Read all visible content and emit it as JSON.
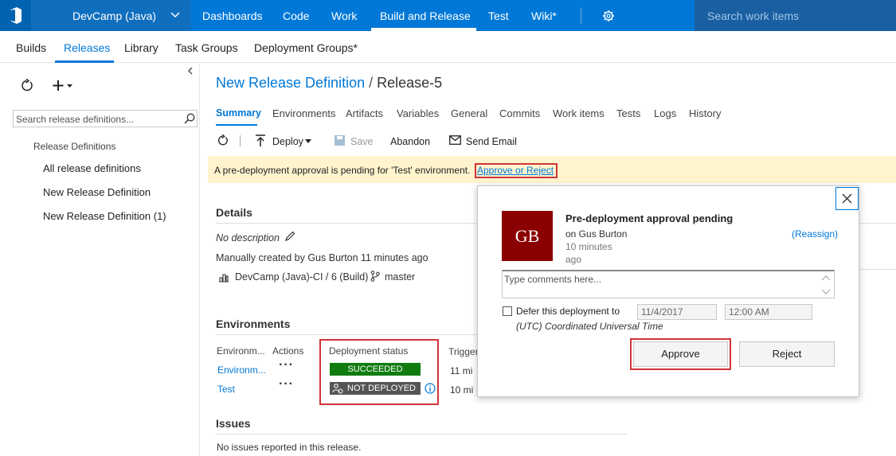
{
  "topbar": {
    "project": "DevCamp (Java)",
    "nav": [
      "Dashboards",
      "Code",
      "Work",
      "Build and Release",
      "Test",
      "Wiki*"
    ],
    "search_placeholder": "Search work items"
  },
  "subnav": [
    "Builds",
    "Releases",
    "Library",
    "Task Groups",
    "Deployment Groups*"
  ],
  "leftpanel": {
    "search_placeholder": "Search release definitions...",
    "section_title": "Release Definitions",
    "items": [
      "All release definitions",
      "New Release Definition",
      "New Release Definition (1)"
    ]
  },
  "header": {
    "definition": "New Release Definition",
    "separator": "/",
    "release": "Release-5"
  },
  "tabs": [
    "Summary",
    "Environments",
    "Artifacts",
    "Variables",
    "General",
    "Commits",
    "Work items",
    "Tests",
    "Logs",
    "History"
  ],
  "toolbar": {
    "deploy": "Deploy",
    "save": "Save",
    "abandon": "Abandon",
    "send_email": "Send Email"
  },
  "banner": {
    "text": "A pre-deployment approval is pending for 'Test' environment.",
    "link": "Approve or Reject"
  },
  "details": {
    "title": "Details",
    "description": "No description",
    "created": "Manually created by Gus Burton 11 minutes ago",
    "build": "DevCamp (Java)-CI / 6 (Build)",
    "branch": "master"
  },
  "environments": {
    "title": "Environments",
    "headers": [
      "Environm...",
      "Actions",
      "Deployment status",
      "Trigger"
    ],
    "rows": [
      {
        "name": "Environm...",
        "status": "SUCCEEDED",
        "trigger": "11 mi"
      },
      {
        "name": "Test",
        "status": "NOT DEPLOYED",
        "trigger": "10 mi"
      }
    ]
  },
  "issues": {
    "title": "Issues",
    "text": "No issues reported in this release."
  },
  "dialog": {
    "avatar": "GB",
    "title": "Pre-deployment approval pending",
    "on": "on Gus Burton",
    "time1": "10 minutes",
    "time2": "ago",
    "reassign": "(Reassign)",
    "comments_placeholder": "Type comments here...",
    "defer_label": "Defer this deployment to",
    "date": "11/4/2017",
    "time": "12:00 AM",
    "timezone": "(UTC) Coordinated Universal Time",
    "approve": "Approve",
    "reject": "Reject"
  },
  "colors": {
    "brand": "#0078d7",
    "succeeded": "#107c10",
    "not_deployed": "#555555",
    "banner": "#fff4ce",
    "highlight": "#d13438",
    "avatar_bg": "#8b0000"
  }
}
